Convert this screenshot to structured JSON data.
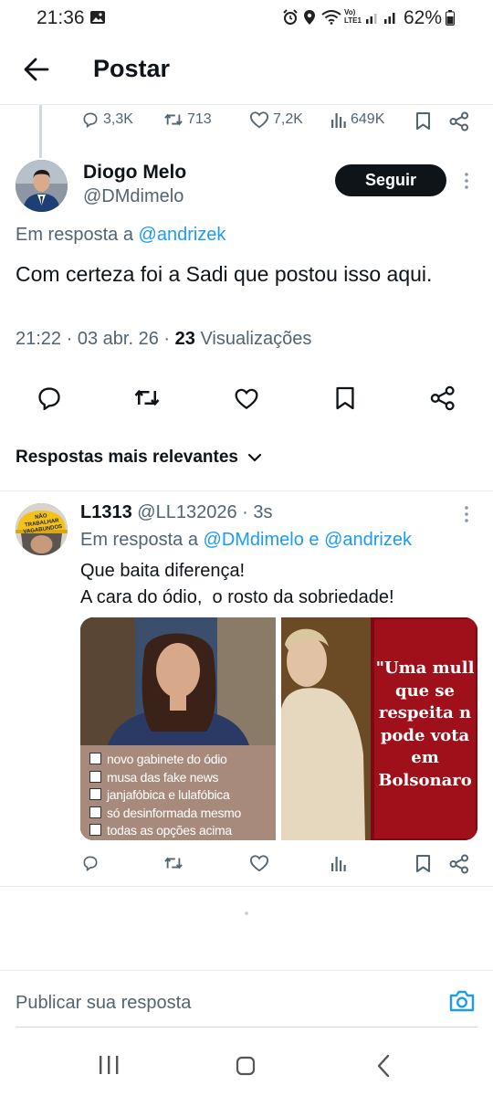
{
  "status_bar": {
    "time": "21:36",
    "network": "Vo) LTE1",
    "battery": "62%"
  },
  "header": {
    "title": "Postar"
  },
  "parent_tweet_stats": {
    "replies": "3,3K",
    "retweets": "713",
    "likes": "7,2K",
    "views": "649K"
  },
  "main_tweet": {
    "name": "Diogo Melo",
    "handle": "@DMdimelo",
    "follow_label": "Seguir",
    "reply_prefix": "Em resposta a",
    "reply_to": "@andrizek",
    "text": "Com certeza foi a Sadi que postou isso aqui.",
    "time": "21:22",
    "date": "03 abr. 26",
    "views_count": "23",
    "views_label": "Visualizações"
  },
  "replies_section": {
    "sort_label": "Respostas mais relevantes"
  },
  "reply": {
    "name": "L1313",
    "handle": "@LL132026",
    "age": "3s",
    "reply_prefix": "Em resposta a",
    "reply_to_1": "@DMdimelo",
    "reply_conj": "e",
    "reply_to_2": "@andrizek",
    "line1": "Que baita diferença!",
    "line2": "A cara do ódio,  o rosto da sobriedade!",
    "avatar_text": "NÃO TRABALHAR VAGABUNDOS",
    "image1_checklist": [
      "novo gabinete do ódio",
      "musa das fake news",
      "janjafóbica e lulafóbica",
      "só desinformada mesmo",
      "todas as opções acima"
    ],
    "image2_quote": [
      "\"Uma mull",
      "que se",
      "respeita n",
      "pode vota",
      "em",
      "Bolsonaro"
    ]
  },
  "composer": {
    "placeholder": "Publicar sua resposta"
  },
  "colors": {
    "accent": "#1d9bf0",
    "text": "#0f1419",
    "muted": "#536471",
    "follow_bg": "#0f1419",
    "image2_red": "#a0101a"
  }
}
